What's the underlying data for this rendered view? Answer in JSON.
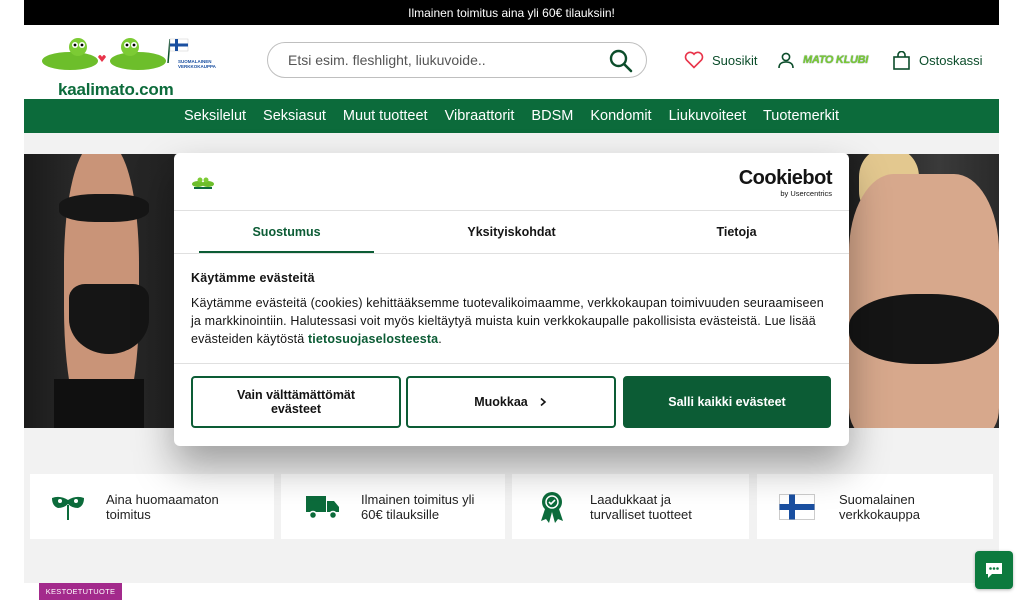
{
  "topbar": {
    "text": "Ilmainen toimitus aina yli 60€ tilauksiin!"
  },
  "header": {
    "logo_text": "kaalimato.com",
    "logo_badge": "SUOMALAINEN VERKKOKAUPPA",
    "search_placeholder": "Etsi esim. fleshlight, liukuvoide..",
    "favorites_label": "Suosikit",
    "club_label": "MATO KLUBI",
    "cart_label": "Ostoskassi"
  },
  "nav": {
    "items": [
      "Seksilelut",
      "Seksiasut",
      "Muut tuotteet",
      "Vibraattorit",
      "BDSM",
      "Kondomit",
      "Liukuvoiteet",
      "Tuotemerkit"
    ]
  },
  "features": [
    {
      "icon": "mask-icon",
      "text": "Aina huomaamaton\ntoimitus"
    },
    {
      "icon": "truck-icon",
      "text": "Ilmainen toimitus yli\n60€ tilauksille"
    },
    {
      "icon": "award-icon",
      "text": "Laadukkaat ja\nturvalliset tuotteet"
    },
    {
      "icon": "finland-flag-icon",
      "text": "Suomalainen\nverkkokauppa"
    }
  ],
  "badge": "KESTOETUTUOTE",
  "cookie": {
    "brand": "Cookiebot",
    "brand_sub": "by Usercentrics",
    "tabs": [
      "Suostumus",
      "Yksityiskohdat",
      "Tietoja"
    ],
    "title": "Käytämme evästeitä",
    "body": "Käytämme evästeitä (cookies) kehittääksemme tuotevalikoimaamme, verkkokaupan toimivuuden seuraamiseen ja markkinointiin. Halutessasi voit myös kieltäytyä muista kuin verkkokaupalle pakollisista evästeistä. Lue lisää evästeiden käytöstä ",
    "link": "tietosuojaselosteesta",
    "body_end": ".",
    "btn_necessary": "Vain välttämättömät evästeet",
    "btn_customize": "Muokkaa",
    "btn_allow": "Salli kaikki evästeet"
  },
  "colors": {
    "brand_green": "#0c6b3b",
    "badge_purple": "#a32a8c"
  }
}
